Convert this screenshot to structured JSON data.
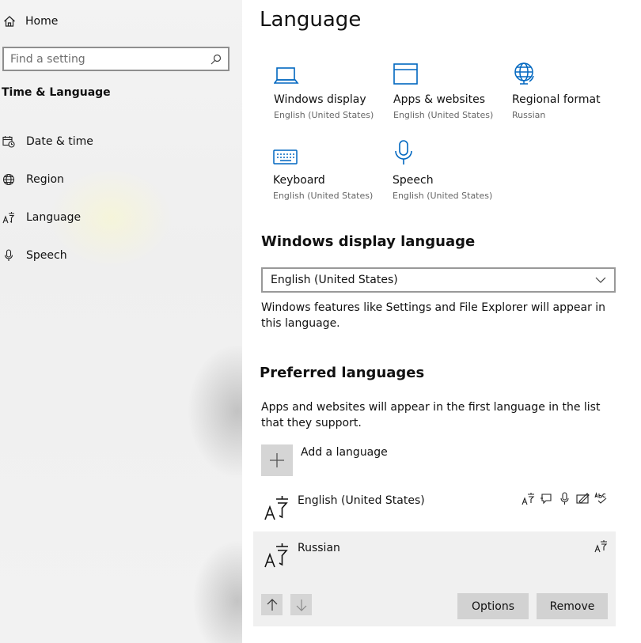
{
  "sidebar": {
    "home_label": "Home",
    "search_placeholder": "Find a setting",
    "section_title": "Time & Language",
    "items": [
      {
        "label": "Date & time",
        "icon": "calendar-clock-icon"
      },
      {
        "label": "Region",
        "icon": "globe-icon"
      },
      {
        "label": "Language",
        "icon": "language-icon"
      },
      {
        "label": "Speech",
        "icon": "microphone-icon"
      }
    ]
  },
  "main": {
    "title": "Language",
    "tiles": [
      {
        "name": "Windows display",
        "sub": "English (United States)",
        "icon": "laptop-icon"
      },
      {
        "name": "Apps & websites",
        "sub": "English (United States)",
        "icon": "window-icon"
      },
      {
        "name": "Regional format",
        "sub": "Russian",
        "icon": "globe-icon"
      },
      {
        "name": "Keyboard",
        "sub": "English (United States)",
        "icon": "keyboard-icon"
      },
      {
        "name": "Speech",
        "sub": "English (United States)",
        "icon": "microphone-icon"
      }
    ],
    "display_language": {
      "heading": "Windows display language",
      "selected": "English (United States)",
      "description": "Windows features like Settings and File Explorer will appear in this language."
    },
    "preferred": {
      "heading": "Preferred languages",
      "description": "Apps and websites will appear in the first language in the list that they support.",
      "add_label": "Add a language",
      "languages": [
        {
          "name": "English (United States)",
          "features": [
            "language-pack-icon",
            "text-to-speech-icon",
            "speech-recognition-icon",
            "handwriting-icon",
            "spell-check-icon"
          ]
        },
        {
          "name": "Russian",
          "features": [
            "language-pack-icon"
          ]
        }
      ],
      "options_label": "Options",
      "remove_label": "Remove"
    }
  },
  "colors": {
    "accent": "#0067c0",
    "sidebar_bg": "#f2f2f2",
    "button_bg": "#d2d2d2",
    "selected_row_bg": "#f0f0f0"
  }
}
